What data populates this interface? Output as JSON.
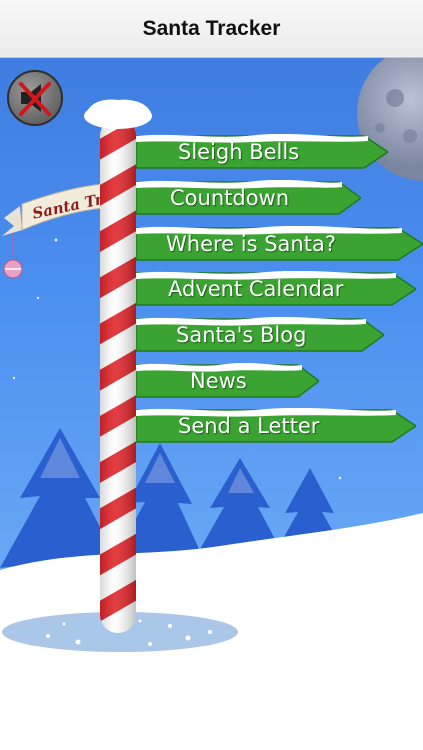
{
  "navbar": {
    "title": "Santa Tracker"
  },
  "banner": {
    "text": "Santa Tr"
  },
  "menu": [
    {
      "label": "Sleigh Bells"
    },
    {
      "label": "Countdown"
    },
    {
      "label": "Where is Santa?"
    },
    {
      "label": "Advent Calendar"
    },
    {
      "label": "Santa's Blog"
    },
    {
      "label": "News"
    },
    {
      "label": "Send a Letter"
    }
  ],
  "colors": {
    "sky": "#4b8ff0",
    "sign_green": "#3aa332",
    "pole_red": "#e0262b",
    "snow": "#ffffff",
    "trees": "#2a5fcf"
  },
  "icons": {
    "mute": "muted-speaker-icon"
  }
}
